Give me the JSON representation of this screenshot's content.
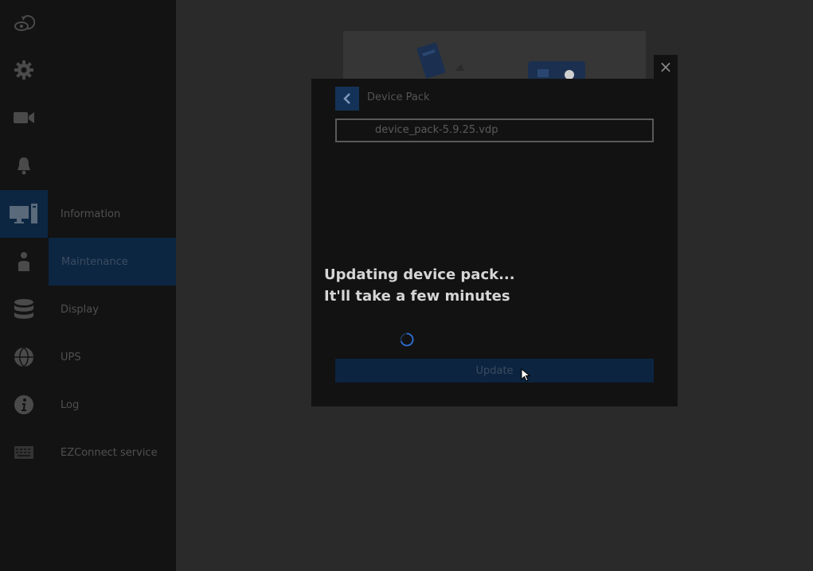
{
  "rail": {
    "icons": [
      "undo-eye-icon",
      "gear-icon",
      "camera-icon",
      "bell-icon",
      "monitor-icon",
      "user-icon",
      "database-icon",
      "globe-icon",
      "info-icon",
      "keyboard-icon"
    ]
  },
  "submenu": {
    "items": [
      {
        "label": "Information"
      },
      {
        "label": "Maintenance",
        "active": true
      },
      {
        "label": "Display"
      },
      {
        "label": "UPS"
      },
      {
        "label": "Log"
      },
      {
        "label": "EZConnect service"
      }
    ]
  },
  "dialog": {
    "title": "Device Pack",
    "file_name": "device_pack-5.9.25.vdp",
    "message_line1": "Updating device pack...",
    "message_line2": "It'll take a few minutes",
    "update_label": "Update",
    "close_symbol": "×"
  },
  "colors": {
    "accent": "#0c2642",
    "button_blue": "#143257",
    "spinner": "#2f6fd6"
  }
}
